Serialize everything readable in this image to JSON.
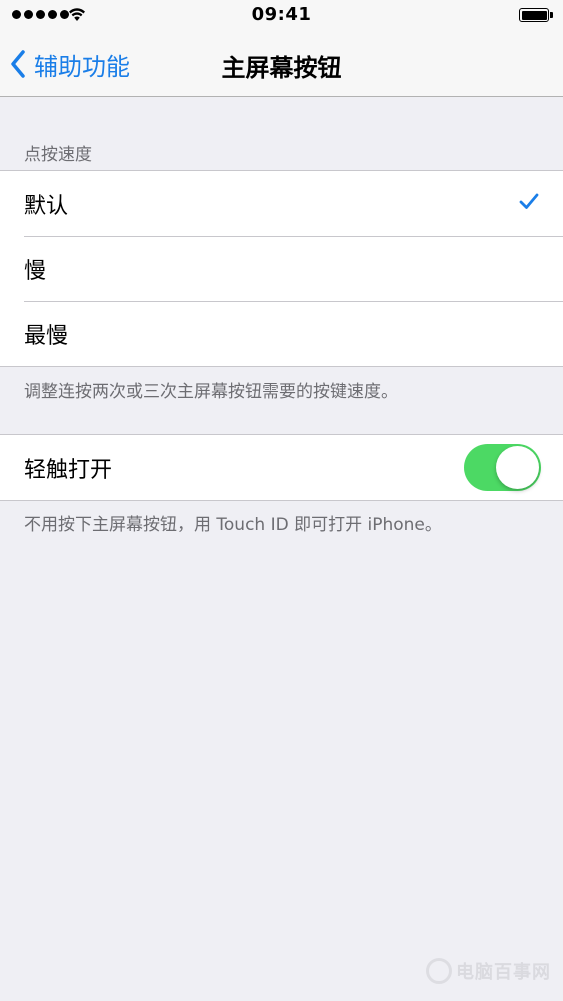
{
  "status_bar": {
    "time": "09:41"
  },
  "nav": {
    "back_label": "辅助功能",
    "title": "主屏幕按钮"
  },
  "speed_section": {
    "header": "点按速度",
    "options": [
      {
        "label": "默认",
        "selected": true
      },
      {
        "label": "慢",
        "selected": false
      },
      {
        "label": "最慢",
        "selected": false
      }
    ],
    "footer": "调整连按两次或三次主屏幕按钮需要的按键速度。"
  },
  "rest_finger_section": {
    "label": "轻触打开",
    "toggle_on": true,
    "footer": "不用按下主屏幕按钮，用 Touch ID 即可打开 iPhone。"
  },
  "watermark": {
    "text": "电脑百事网"
  },
  "colors": {
    "accent": "#1a7ee8",
    "toggle_on": "#4cd964",
    "background": "#efeff4",
    "secondary_text": "#6d6d72"
  },
  "icons": {
    "back": "chevron-left-icon",
    "selected": "checkmark-icon",
    "signal": "cellular-signal-icon",
    "wifi": "wifi-icon",
    "battery": "battery-icon"
  }
}
